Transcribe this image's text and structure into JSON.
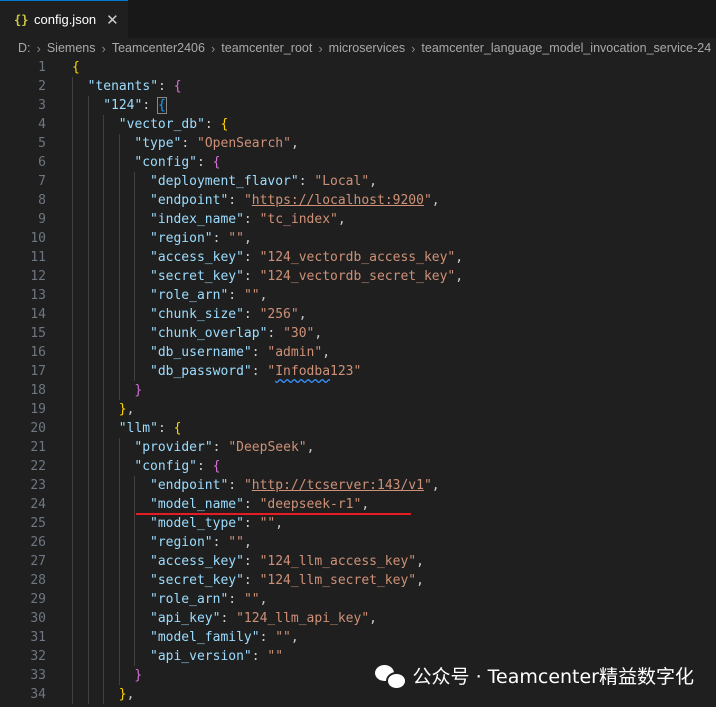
{
  "tab": {
    "icon": "json-braces-icon",
    "icon_text": "{}",
    "title": "config.json",
    "close": "✕"
  },
  "breadcrumb": [
    "D:",
    "Siemens",
    "Teamcenter2406",
    "teamcenter_root",
    "microservices",
    "teamcenter_language_model_invocation_service-24"
  ],
  "breadcrumb_sep": "›",
  "lines": [
    {
      "n": "1",
      "indent": 0,
      "t": [
        [
          "{",
          "b1"
        ]
      ]
    },
    {
      "n": "2",
      "indent": 1,
      "t": [
        [
          "\"tenants\"",
          "k"
        ],
        [
          ": ",
          "p"
        ],
        [
          "{",
          "b2"
        ]
      ]
    },
    {
      "n": "3",
      "indent": 2,
      "t": [
        [
          "\"124\"",
          "k"
        ],
        [
          ": ",
          "p"
        ],
        [
          "{",
          "b3"
        ]
      ]
    },
    {
      "n": "4",
      "indent": 3,
      "t": [
        [
          "\"vector_db\"",
          "k"
        ],
        [
          ": ",
          "p"
        ],
        [
          "{",
          "b1"
        ]
      ]
    },
    {
      "n": "5",
      "indent": 4,
      "t": [
        [
          "\"type\"",
          "k"
        ],
        [
          ": ",
          "p"
        ],
        [
          "\"OpenSearch\"",
          "s"
        ],
        [
          ",",
          "p"
        ]
      ]
    },
    {
      "n": "6",
      "indent": 4,
      "t": [
        [
          "\"config\"",
          "k"
        ],
        [
          ": ",
          "p"
        ],
        [
          "{",
          "b2"
        ]
      ]
    },
    {
      "n": "7",
      "indent": 5,
      "t": [
        [
          "\"deployment_flavor\"",
          "k"
        ],
        [
          ": ",
          "p"
        ],
        [
          "\"Local\"",
          "s"
        ],
        [
          ",",
          "p"
        ]
      ]
    },
    {
      "n": "8",
      "indent": 5,
      "t": [
        [
          "\"endpoint\"",
          "k"
        ],
        [
          ": ",
          "p"
        ],
        [
          "\"",
          "s"
        ],
        [
          "https://localhost:9200",
          "s link"
        ],
        [
          "\"",
          "s"
        ],
        [
          ",",
          "p"
        ]
      ]
    },
    {
      "n": "9",
      "indent": 5,
      "t": [
        [
          "\"index_name\"",
          "k"
        ],
        [
          ": ",
          "p"
        ],
        [
          "\"tc_index\"",
          "s"
        ],
        [
          ",",
          "p"
        ]
      ]
    },
    {
      "n": "10",
      "indent": 5,
      "t": [
        [
          "\"region\"",
          "k"
        ],
        [
          ": ",
          "p"
        ],
        [
          "\"\"",
          "s"
        ],
        [
          ",",
          "p"
        ]
      ]
    },
    {
      "n": "11",
      "indent": 5,
      "t": [
        [
          "\"access_key\"",
          "k"
        ],
        [
          ": ",
          "p"
        ],
        [
          "\"124_vectordb_access_key\"",
          "s"
        ],
        [
          ",",
          "p"
        ]
      ]
    },
    {
      "n": "12",
      "indent": 5,
      "t": [
        [
          "\"secret_key\"",
          "k"
        ],
        [
          ": ",
          "p"
        ],
        [
          "\"124_vectordb_secret_key\"",
          "s"
        ],
        [
          ",",
          "p"
        ]
      ]
    },
    {
      "n": "13",
      "indent": 5,
      "t": [
        [
          "\"role_arn\"",
          "k"
        ],
        [
          ": ",
          "p"
        ],
        [
          "\"\"",
          "s"
        ],
        [
          ",",
          "p"
        ]
      ]
    },
    {
      "n": "14",
      "indent": 5,
      "t": [
        [
          "\"chunk_size\"",
          "k"
        ],
        [
          ": ",
          "p"
        ],
        [
          "\"256\"",
          "s"
        ],
        [
          ",",
          "p"
        ]
      ]
    },
    {
      "n": "15",
      "indent": 5,
      "t": [
        [
          "\"chunk_overlap\"",
          "k"
        ],
        [
          ": ",
          "p"
        ],
        [
          "\"30\"",
          "s"
        ],
        [
          ",",
          "p"
        ]
      ]
    },
    {
      "n": "16",
      "indent": 5,
      "t": [
        [
          "\"db_username\"",
          "k"
        ],
        [
          ": ",
          "p"
        ],
        [
          "\"admin\"",
          "s"
        ],
        [
          ",",
          "p"
        ]
      ]
    },
    {
      "n": "17",
      "indent": 5,
      "t": [
        [
          "\"db_password\"",
          "k"
        ],
        [
          ": ",
          "p"
        ],
        [
          "\"",
          "s"
        ],
        [
          "Infodba",
          "s squiggle"
        ],
        [
          "123\"",
          "s"
        ]
      ]
    },
    {
      "n": "18",
      "indent": 4,
      "t": [
        [
          "}",
          "b2"
        ]
      ]
    },
    {
      "n": "19",
      "indent": 3,
      "t": [
        [
          "}",
          "b1"
        ],
        [
          ",",
          "p"
        ]
      ]
    },
    {
      "n": "20",
      "indent": 3,
      "t": [
        [
          "\"llm\"",
          "k"
        ],
        [
          ": ",
          "p"
        ],
        [
          "{",
          "b1"
        ]
      ]
    },
    {
      "n": "21",
      "indent": 4,
      "t": [
        [
          "\"provider\"",
          "k"
        ],
        [
          ": ",
          "p"
        ],
        [
          "\"DeepSeek\"",
          "s"
        ],
        [
          ",",
          "p"
        ]
      ]
    },
    {
      "n": "22",
      "indent": 4,
      "t": [
        [
          "\"config\"",
          "k"
        ],
        [
          ": ",
          "p"
        ],
        [
          "{",
          "b2"
        ]
      ]
    },
    {
      "n": "23",
      "indent": 5,
      "t": [
        [
          "\"endpoint\"",
          "k"
        ],
        [
          ": ",
          "p"
        ],
        [
          "\"",
          "s"
        ],
        [
          "http://tcserver:143/v1",
          "s link"
        ],
        [
          "\"",
          "s"
        ],
        [
          ",",
          "p"
        ]
      ]
    },
    {
      "n": "24",
      "indent": 5,
      "t": [
        [
          "\"model_name\"",
          "k"
        ],
        [
          ": ",
          "p"
        ],
        [
          "\"deepseek-r1\"",
          "s"
        ],
        [
          ",",
          "p"
        ]
      ]
    },
    {
      "n": "25",
      "indent": 5,
      "t": [
        [
          "\"model_type\"",
          "k"
        ],
        [
          ": ",
          "p"
        ],
        [
          "\"\"",
          "s"
        ],
        [
          ",",
          "p"
        ]
      ]
    },
    {
      "n": "26",
      "indent": 5,
      "t": [
        [
          "\"region\"",
          "k"
        ],
        [
          ": ",
          "p"
        ],
        [
          "\"\"",
          "s"
        ],
        [
          ",",
          "p"
        ]
      ]
    },
    {
      "n": "27",
      "indent": 5,
      "t": [
        [
          "\"access_key\"",
          "k"
        ],
        [
          ": ",
          "p"
        ],
        [
          "\"124_llm_access_key\"",
          "s"
        ],
        [
          ",",
          "p"
        ]
      ]
    },
    {
      "n": "28",
      "indent": 5,
      "t": [
        [
          "\"secret_key\"",
          "k"
        ],
        [
          ": ",
          "p"
        ],
        [
          "\"124_llm_secret_key\"",
          "s"
        ],
        [
          ",",
          "p"
        ]
      ]
    },
    {
      "n": "29",
      "indent": 5,
      "t": [
        [
          "\"role_arn\"",
          "k"
        ],
        [
          ": ",
          "p"
        ],
        [
          "\"\"",
          "s"
        ],
        [
          ",",
          "p"
        ]
      ]
    },
    {
      "n": "30",
      "indent": 5,
      "t": [
        [
          "\"api_key\"",
          "k"
        ],
        [
          ": ",
          "p"
        ],
        [
          "\"124_llm_api_key\"",
          "s"
        ],
        [
          ",",
          "p"
        ]
      ]
    },
    {
      "n": "31",
      "indent": 5,
      "t": [
        [
          "\"model_family\"",
          "k"
        ],
        [
          ": ",
          "p"
        ],
        [
          "\"\"",
          "s"
        ],
        [
          ",",
          "p"
        ]
      ]
    },
    {
      "n": "32",
      "indent": 5,
      "t": [
        [
          "\"api_version\"",
          "k"
        ],
        [
          ": ",
          "p"
        ],
        [
          "\"\"",
          "s"
        ]
      ]
    },
    {
      "n": "33",
      "indent": 4,
      "t": [
        [
          "}",
          "b2"
        ]
      ]
    },
    {
      "n": "34",
      "indent": 3,
      "t": [
        [
          "}",
          "b1"
        ],
        [
          ",",
          "p"
        ]
      ]
    }
  ],
  "annotation": {
    "highlighted_line": "24",
    "color": "#e51c23"
  },
  "watermark": {
    "icon": "wechat-icon",
    "text": "公众号 · Teamcenter精益数字化"
  },
  "colors": {
    "background": "#1f1f1f",
    "key": "#9cdcfe",
    "string": "#ce9178",
    "bracket_gold": "#ffd700",
    "bracket_orchid": "#da70d6",
    "bracket_blue": "#179fff",
    "line_number": "#6e7681"
  }
}
